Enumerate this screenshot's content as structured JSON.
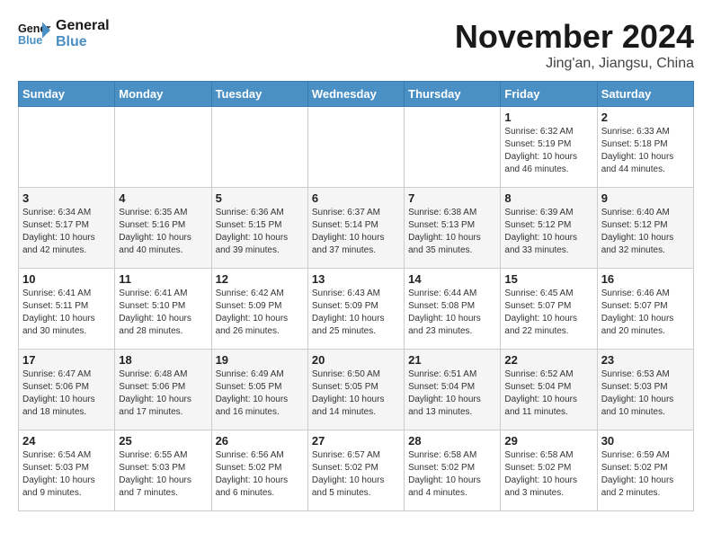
{
  "header": {
    "logo_line1": "General",
    "logo_line2": "Blue",
    "month_title": "November 2024",
    "location": "Jing'an, Jiangsu, China"
  },
  "days_of_week": [
    "Sunday",
    "Monday",
    "Tuesday",
    "Wednesday",
    "Thursday",
    "Friday",
    "Saturday"
  ],
  "weeks": [
    [
      {
        "day": "",
        "info": ""
      },
      {
        "day": "",
        "info": ""
      },
      {
        "day": "",
        "info": ""
      },
      {
        "day": "",
        "info": ""
      },
      {
        "day": "",
        "info": ""
      },
      {
        "day": "1",
        "info": "Sunrise: 6:32 AM\nSunset: 5:19 PM\nDaylight: 10 hours\nand 46 minutes."
      },
      {
        "day": "2",
        "info": "Sunrise: 6:33 AM\nSunset: 5:18 PM\nDaylight: 10 hours\nand 44 minutes."
      }
    ],
    [
      {
        "day": "3",
        "info": "Sunrise: 6:34 AM\nSunset: 5:17 PM\nDaylight: 10 hours\nand 42 minutes."
      },
      {
        "day": "4",
        "info": "Sunrise: 6:35 AM\nSunset: 5:16 PM\nDaylight: 10 hours\nand 40 minutes."
      },
      {
        "day": "5",
        "info": "Sunrise: 6:36 AM\nSunset: 5:15 PM\nDaylight: 10 hours\nand 39 minutes."
      },
      {
        "day": "6",
        "info": "Sunrise: 6:37 AM\nSunset: 5:14 PM\nDaylight: 10 hours\nand 37 minutes."
      },
      {
        "day": "7",
        "info": "Sunrise: 6:38 AM\nSunset: 5:13 PM\nDaylight: 10 hours\nand 35 minutes."
      },
      {
        "day": "8",
        "info": "Sunrise: 6:39 AM\nSunset: 5:12 PM\nDaylight: 10 hours\nand 33 minutes."
      },
      {
        "day": "9",
        "info": "Sunrise: 6:40 AM\nSunset: 5:12 PM\nDaylight: 10 hours\nand 32 minutes."
      }
    ],
    [
      {
        "day": "10",
        "info": "Sunrise: 6:41 AM\nSunset: 5:11 PM\nDaylight: 10 hours\nand 30 minutes."
      },
      {
        "day": "11",
        "info": "Sunrise: 6:41 AM\nSunset: 5:10 PM\nDaylight: 10 hours\nand 28 minutes."
      },
      {
        "day": "12",
        "info": "Sunrise: 6:42 AM\nSunset: 5:09 PM\nDaylight: 10 hours\nand 26 minutes."
      },
      {
        "day": "13",
        "info": "Sunrise: 6:43 AM\nSunset: 5:09 PM\nDaylight: 10 hours\nand 25 minutes."
      },
      {
        "day": "14",
        "info": "Sunrise: 6:44 AM\nSunset: 5:08 PM\nDaylight: 10 hours\nand 23 minutes."
      },
      {
        "day": "15",
        "info": "Sunrise: 6:45 AM\nSunset: 5:07 PM\nDaylight: 10 hours\nand 22 minutes."
      },
      {
        "day": "16",
        "info": "Sunrise: 6:46 AM\nSunset: 5:07 PM\nDaylight: 10 hours\nand 20 minutes."
      }
    ],
    [
      {
        "day": "17",
        "info": "Sunrise: 6:47 AM\nSunset: 5:06 PM\nDaylight: 10 hours\nand 18 minutes."
      },
      {
        "day": "18",
        "info": "Sunrise: 6:48 AM\nSunset: 5:06 PM\nDaylight: 10 hours\nand 17 minutes."
      },
      {
        "day": "19",
        "info": "Sunrise: 6:49 AM\nSunset: 5:05 PM\nDaylight: 10 hours\nand 16 minutes."
      },
      {
        "day": "20",
        "info": "Sunrise: 6:50 AM\nSunset: 5:05 PM\nDaylight: 10 hours\nand 14 minutes."
      },
      {
        "day": "21",
        "info": "Sunrise: 6:51 AM\nSunset: 5:04 PM\nDaylight: 10 hours\nand 13 minutes."
      },
      {
        "day": "22",
        "info": "Sunrise: 6:52 AM\nSunset: 5:04 PM\nDaylight: 10 hours\nand 11 minutes."
      },
      {
        "day": "23",
        "info": "Sunrise: 6:53 AM\nSunset: 5:03 PM\nDaylight: 10 hours\nand 10 minutes."
      }
    ],
    [
      {
        "day": "24",
        "info": "Sunrise: 6:54 AM\nSunset: 5:03 PM\nDaylight: 10 hours\nand 9 minutes."
      },
      {
        "day": "25",
        "info": "Sunrise: 6:55 AM\nSunset: 5:03 PM\nDaylight: 10 hours\nand 7 minutes."
      },
      {
        "day": "26",
        "info": "Sunrise: 6:56 AM\nSunset: 5:02 PM\nDaylight: 10 hours\nand 6 minutes."
      },
      {
        "day": "27",
        "info": "Sunrise: 6:57 AM\nSunset: 5:02 PM\nDaylight: 10 hours\nand 5 minutes."
      },
      {
        "day": "28",
        "info": "Sunrise: 6:58 AM\nSunset: 5:02 PM\nDaylight: 10 hours\nand 4 minutes."
      },
      {
        "day": "29",
        "info": "Sunrise: 6:58 AM\nSunset: 5:02 PM\nDaylight: 10 hours\nand 3 minutes."
      },
      {
        "day": "30",
        "info": "Sunrise: 6:59 AM\nSunset: 5:02 PM\nDaylight: 10 hours\nand 2 minutes."
      }
    ]
  ]
}
